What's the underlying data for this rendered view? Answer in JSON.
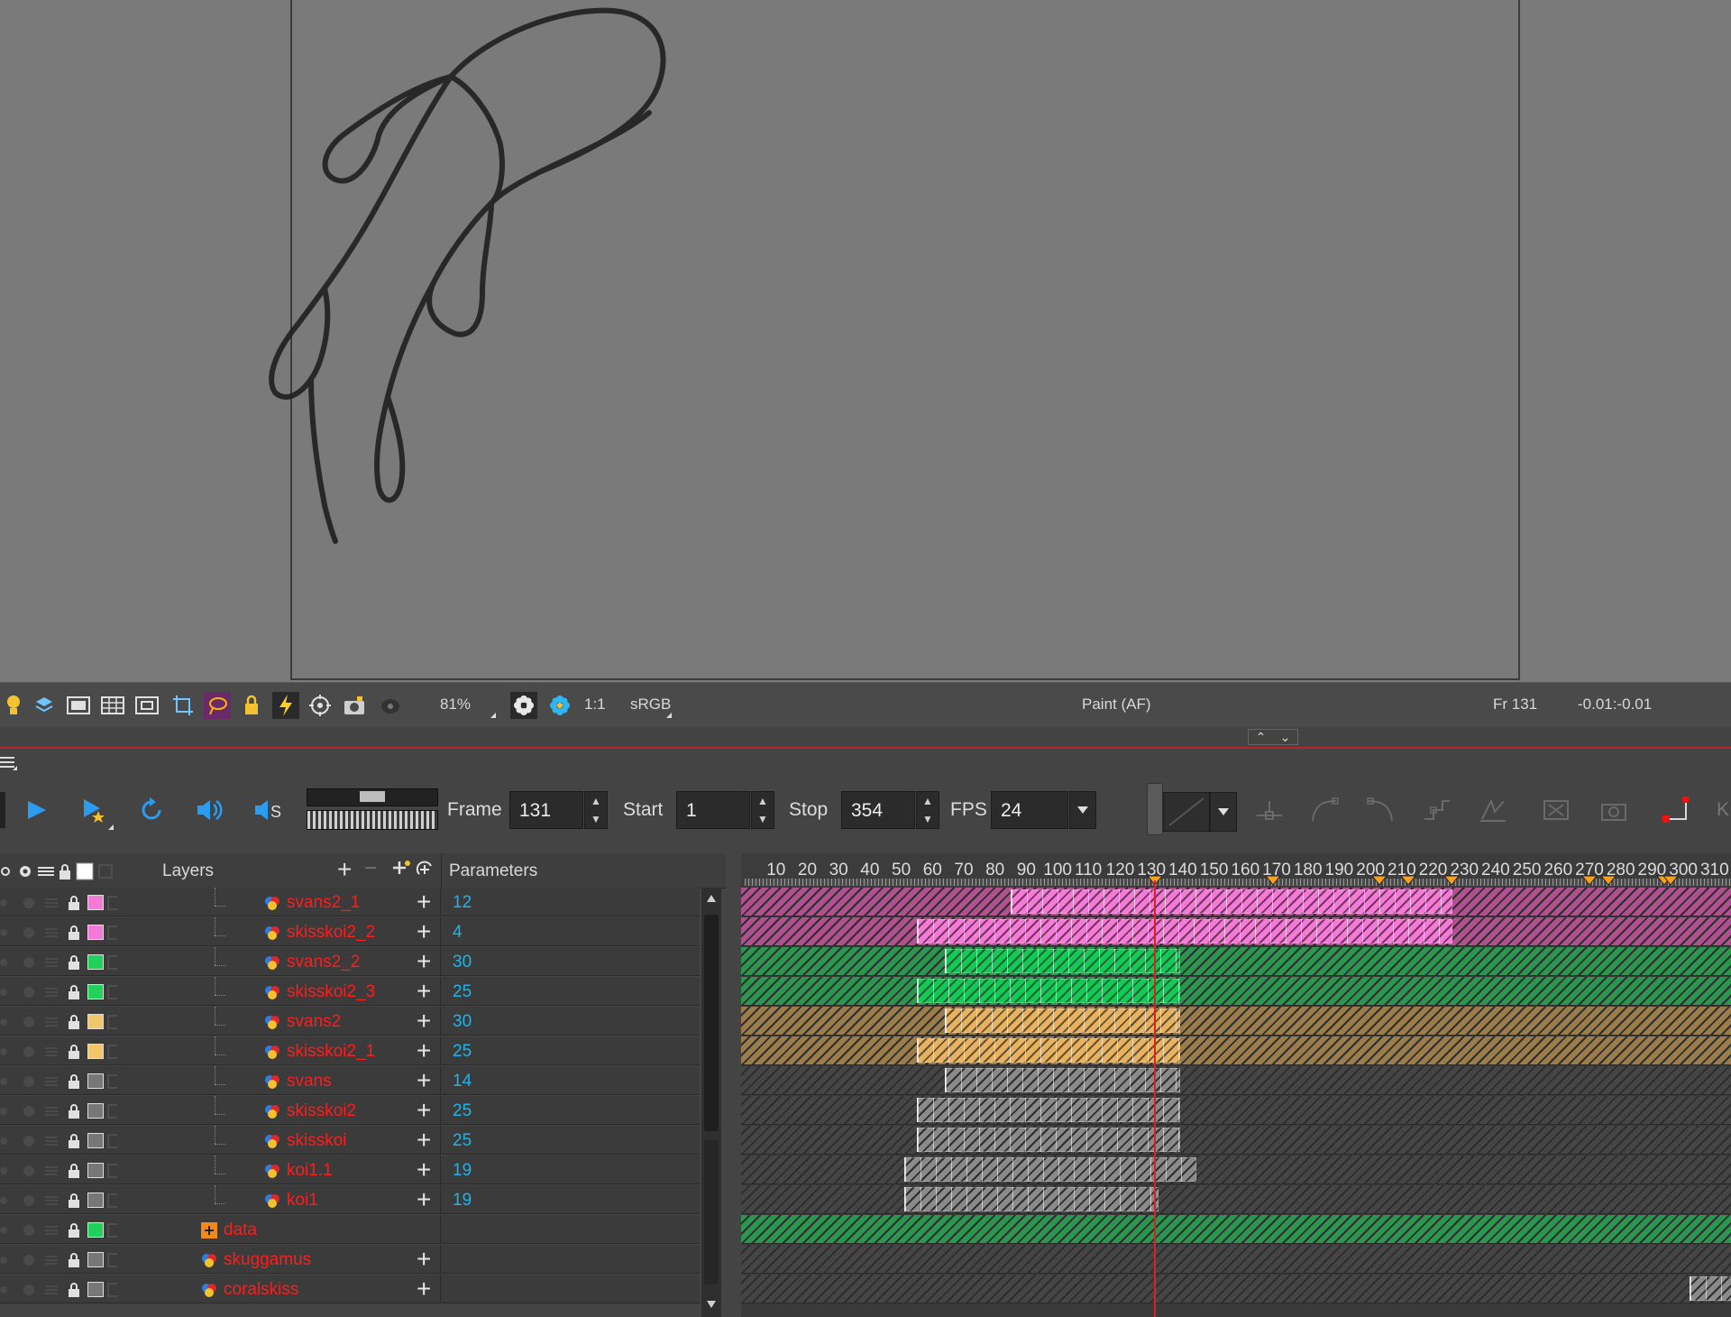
{
  "view_toolbar": {
    "zoom": "81%",
    "ratio": "1:1",
    "color_space": "sRGB",
    "mode": "Paint (AF)",
    "frame_indicator": "Fr 131",
    "coords": "-0.01:-0.01"
  },
  "transport": {
    "frame_label": "Frame",
    "frame_value": "131",
    "start_label": "Start",
    "start_value": "1",
    "stop_label": "Stop",
    "stop_value": "354",
    "fps_label": "FPS",
    "fps_value": "24"
  },
  "layers_header": {
    "title": "Layers",
    "params_title": "Parameters"
  },
  "layers": [
    {
      "name": "svans2_1",
      "param": "12",
      "swatch": "#f37ad6",
      "indent": 2
    },
    {
      "name": "skisskoi2_2",
      "param": "4",
      "swatch": "#f37ad6",
      "indent": 2
    },
    {
      "name": "svans2_2",
      "param": "30",
      "swatch": "#22d15a",
      "indent": 2
    },
    {
      "name": "skisskoi2_3",
      "param": "25",
      "swatch": "#22d15a",
      "indent": 2
    },
    {
      "name": "svans2",
      "param": "30",
      "swatch": "#f2c76b",
      "indent": 2
    },
    {
      "name": "skisskoi2_1",
      "param": "25",
      "swatch": "#f2c76b",
      "indent": 2
    },
    {
      "name": "svans",
      "param": "14",
      "swatch": "#777777",
      "indent": 2
    },
    {
      "name": "skisskoi2",
      "param": "25",
      "swatch": "#777777",
      "indent": 2
    },
    {
      "name": "skisskoi",
      "param": "25",
      "swatch": "#777777",
      "indent": 2
    },
    {
      "name": "koi1.1",
      "param": "19",
      "swatch": "#777777",
      "indent": 2
    },
    {
      "name": "koi1",
      "param": "19",
      "swatch": "#777777",
      "indent": 2
    },
    {
      "name": "data",
      "param": "",
      "swatch": "#22d15a",
      "indent": 1
    },
    {
      "name": "skuggamus",
      "param": "",
      "swatch": "#777777",
      "indent": 1
    },
    {
      "name": "coralskiss",
      "param": "",
      "swatch": "#777777",
      "indent": 1
    }
  ],
  "ruler_ticks": [
    "10",
    "20",
    "30",
    "40",
    "50",
    "60",
    "70",
    "80",
    "90",
    "100",
    "110",
    "120",
    "130",
    "140",
    "150",
    "160",
    "170",
    "180",
    "190",
    "200",
    "210",
    "220",
    "230",
    "240",
    "250",
    "260",
    "270",
    "280",
    "290",
    "300",
    "310"
  ],
  "current_frame": 131,
  "keyframe_markers": [
    131,
    169,
    203,
    212,
    226,
    270,
    276,
    294,
    296
  ],
  "tracks": [
    {
      "color": "#f37ad6",
      "bg": "#b0518f",
      "start": 85,
      "end": 226
    },
    {
      "color": "#f37ad6",
      "bg": "#b0518f",
      "start": 55,
      "end": 226
    },
    {
      "color": "#14c955",
      "bg": "#2c9650",
      "start": 64,
      "end": 139
    },
    {
      "color": "#14c955",
      "bg": "#2c9650",
      "start": 55,
      "end": 139
    },
    {
      "color": "#e7b261",
      "bg": "#9a7d4a",
      "start": 64,
      "end": 139
    },
    {
      "color": "#e7b261",
      "bg": "#9a7d4a",
      "start": 55,
      "end": 139
    },
    {
      "color": "#8a8a8a",
      "bg": "#454545",
      "start": 64,
      "end": 139
    },
    {
      "color": "#8a8a8a",
      "bg": "#454545",
      "start": 55,
      "end": 139
    },
    {
      "color": "#8a8a8a",
      "bg": "#454545",
      "start": 55,
      "end": 139
    },
    {
      "color": "#8a8a8a",
      "bg": "#454545",
      "start": 51,
      "end": 144
    },
    {
      "color": "#8a8a8a",
      "bg": "#454545",
      "start": 51,
      "end": 132
    },
    {
      "color": "#2c9650",
      "bg": "#2c9650",
      "start": 0,
      "end": 0
    },
    {
      "color": "#8a8a8a",
      "bg": "#454545",
      "start": 0,
      "end": 0
    },
    {
      "color": "#8a8a8a",
      "bg": "#454545",
      "start": 302,
      "end": 320
    }
  ]
}
